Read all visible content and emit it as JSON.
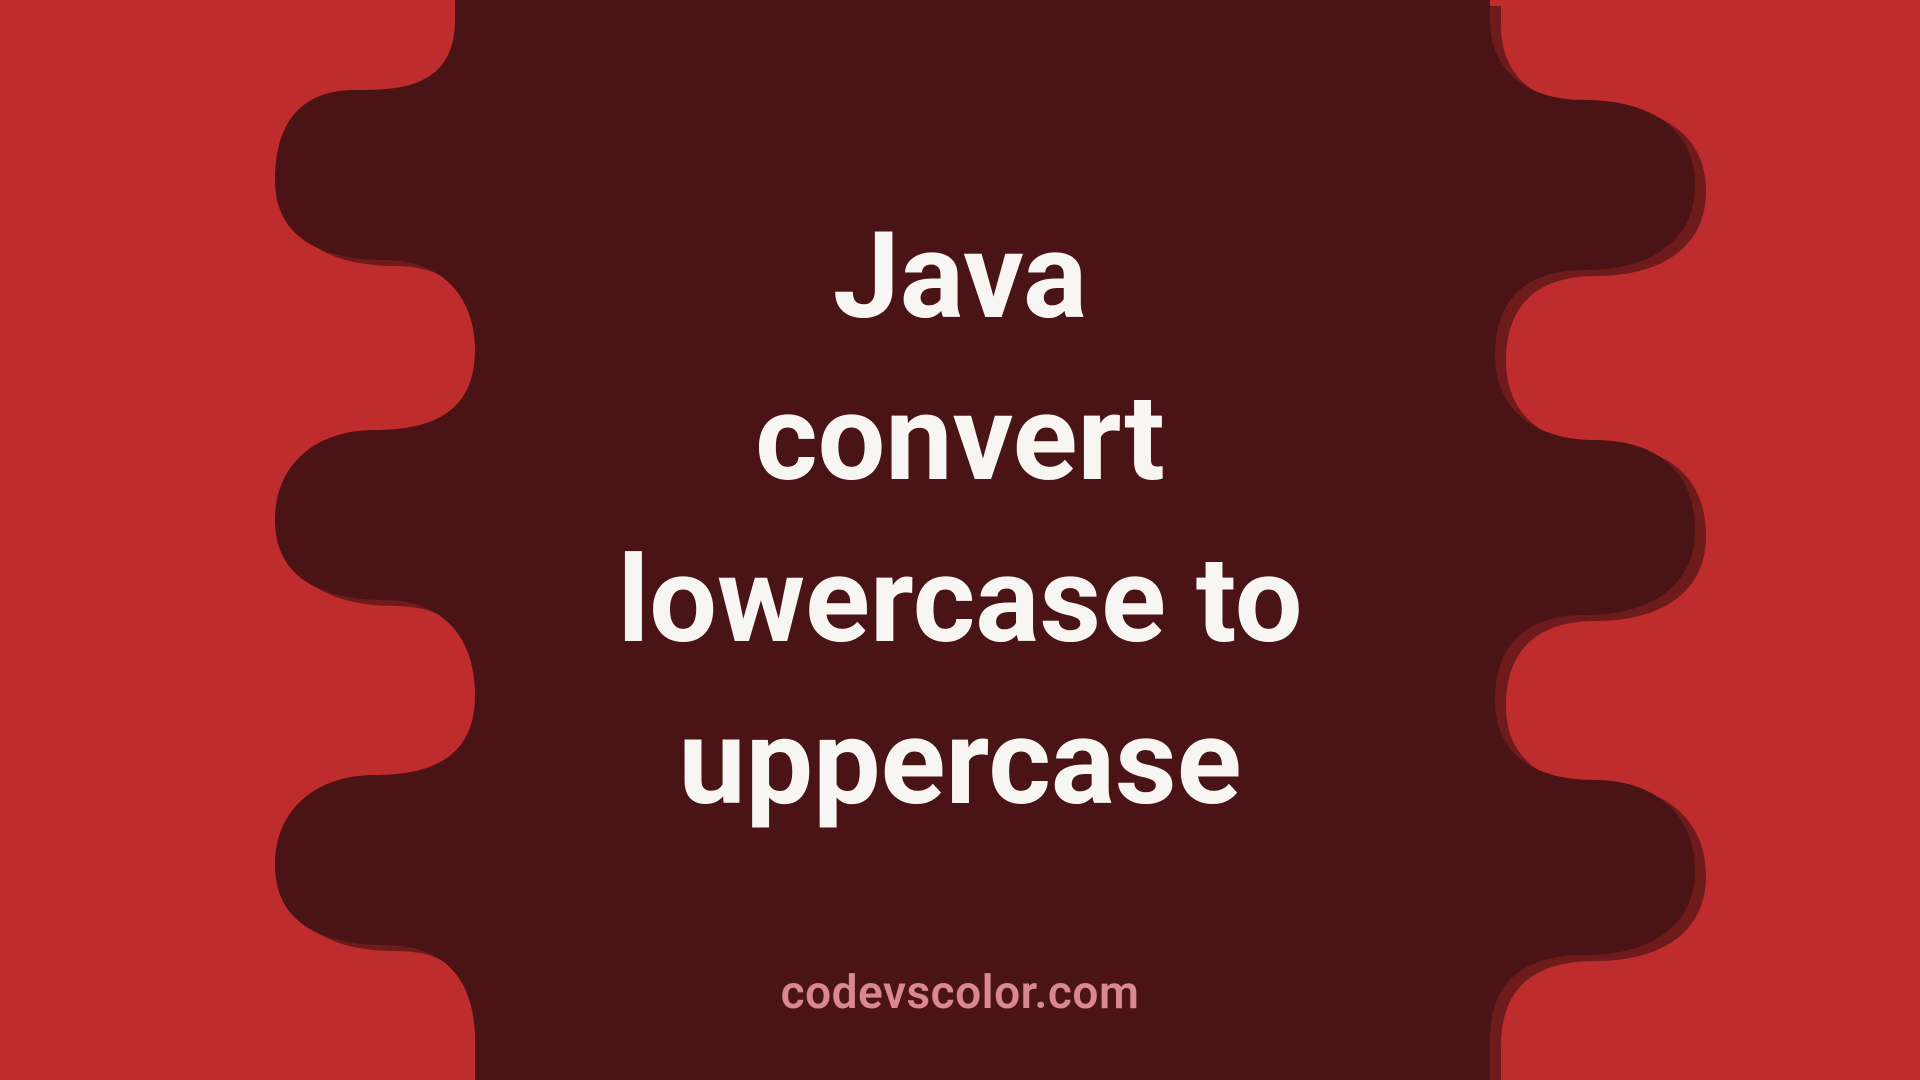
{
  "title_lines": [
    "Java",
    "convert",
    "lowercase to",
    "uppercase"
  ],
  "watermark": "codevscolor.com",
  "colors": {
    "outer": "#be2c2d",
    "inner": "#4a1315",
    "shadow": "#2e0c0d",
    "text": "#f7f6f3",
    "watermark": "#d98790"
  }
}
